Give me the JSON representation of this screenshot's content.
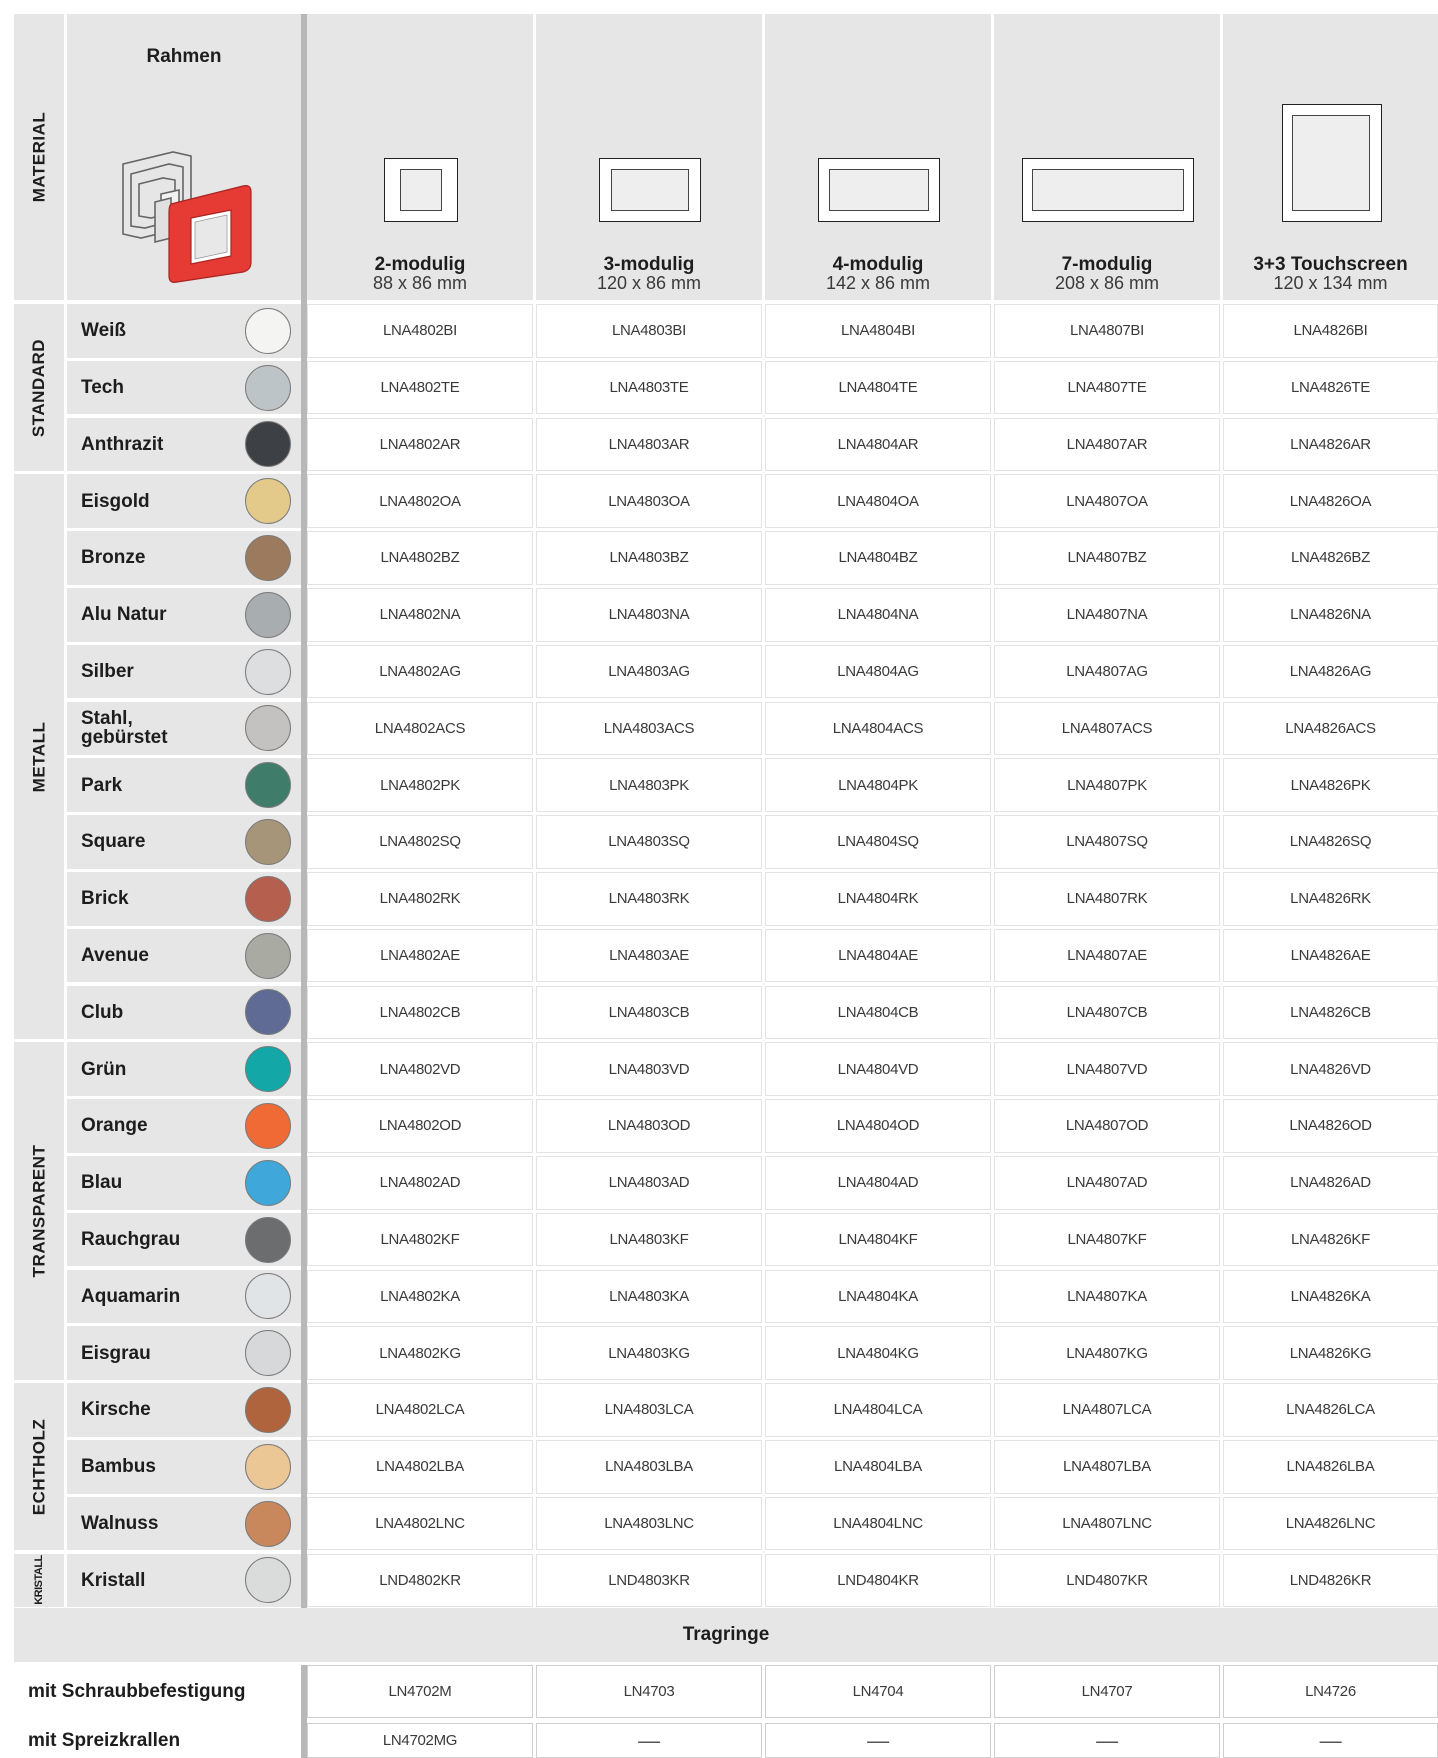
{
  "header": {
    "corner_label": "MATERIAL",
    "frame_title": "Rahmen",
    "columns": [
      {
        "title": "2-modulig",
        "dims": "88 x 86 mm"
      },
      {
        "title": "3-modulig",
        "dims": "120 x 86 mm"
      },
      {
        "title": "4-modulig",
        "dims": "142 x 86 mm"
      },
      {
        "title": "7-modulig",
        "dims": "208 x 86 mm"
      },
      {
        "title": "3+3 Touchscreen",
        "dims": "120 x 134 mm"
      }
    ]
  },
  "groups": [
    {
      "label": "STANDARD"
    },
    {
      "label": "METALL"
    },
    {
      "label": "TRANSPARENT"
    },
    {
      "label": "ECHTHOLZ"
    },
    {
      "label": "KRISTALL"
    }
  ],
  "rows": [
    {
      "name": "Weiß",
      "color": "#f4f4f2",
      "codes": [
        "LNA4802BI",
        "LNA4803BI",
        "LNA4804BI",
        "LNA4807BI",
        "LNA4826BI"
      ]
    },
    {
      "name": "Tech",
      "color": "#bcc4c8",
      "codes": [
        "LNA4802TE",
        "LNA4803TE",
        "LNA4804TE",
        "LNA4807TE",
        "LNA4826TE"
      ]
    },
    {
      "name": "Anthrazit",
      "color": "#3d4146",
      "codes": [
        "LNA4802AR",
        "LNA4803AR",
        "LNA4804AR",
        "LNA4807AR",
        "LNA4826AR"
      ]
    },
    {
      "name": "Eisgold",
      "color": "#e3c98a",
      "codes": [
        "LNA4802OA",
        "LNA4803OA",
        "LNA4804OA",
        "LNA4807OA",
        "LNA4826OA"
      ]
    },
    {
      "name": "Bronze",
      "color": "#9c7a5e",
      "codes": [
        "LNA4802BZ",
        "LNA4803BZ",
        "LNA4804BZ",
        "LNA4807BZ",
        "LNA4826BZ"
      ]
    },
    {
      "name": "Alu Natur",
      "color": "#a8adb0",
      "codes": [
        "LNA4802NA",
        "LNA4803NA",
        "LNA4804NA",
        "LNA4807NA",
        "LNA4826NA"
      ]
    },
    {
      "name": "Silber",
      "color": "#dcdedf",
      "codes": [
        "LNA4802AG",
        "LNA4803AG",
        "LNA4804AG",
        "LNA4807AG",
        "LNA4826AG"
      ]
    },
    {
      "name": "Stahl,\ngebürstet",
      "color": "#c4c2c0",
      "codes": [
        "LNA4802ACS",
        "LNA4803ACS",
        "LNA4804ACS",
        "LNA4807ACS",
        "LNA4826ACS"
      ]
    },
    {
      "name": "Park",
      "color": "#3f7c6a",
      "codes": [
        "LNA4802PK",
        "LNA4803PK",
        "LNA4804PK",
        "LNA4807PK",
        "LNA4826PK"
      ]
    },
    {
      "name": "Square",
      "color": "#a69578",
      "codes": [
        "LNA4802SQ",
        "LNA4803SQ",
        "LNA4804SQ",
        "LNA4807SQ",
        "LNA4826SQ"
      ]
    },
    {
      "name": "Brick",
      "color": "#b55f4f",
      "codes": [
        "LNA4802RK",
        "LNA4803RK",
        "LNA4804RK",
        "LNA4807RK",
        "LNA4826RK"
      ]
    },
    {
      "name": "Avenue",
      "color": "#a9aaa2",
      "codes": [
        "LNA4802AE",
        "LNA4803AE",
        "LNA4804AE",
        "LNA4807AE",
        "LNA4826AE"
      ]
    },
    {
      "name": "Club",
      "color": "#5f6a95",
      "codes": [
        "LNA4802CB",
        "LNA4803CB",
        "LNA4804CB",
        "LNA4807CB",
        "LNA4826CB"
      ]
    },
    {
      "name": "Grün",
      "color": "#14a7a7",
      "codes": [
        "LNA4802VD",
        "LNA4803VD",
        "LNA4804VD",
        "LNA4807VD",
        "LNA4826VD"
      ]
    },
    {
      "name": "Orange",
      "color": "#ef6a35",
      "codes": [
        "LNA4802OD",
        "LNA4803OD",
        "LNA4804OD",
        "LNA4807OD",
        "LNA4826OD"
      ]
    },
    {
      "name": "Blau",
      "color": "#3fa7d9",
      "codes": [
        "LNA4802AD",
        "LNA4803AD",
        "LNA4804AD",
        "LNA4807AD",
        "LNA4826AD"
      ]
    },
    {
      "name": "Rauchgrau",
      "color": "#6b6d6f",
      "codes": [
        "LNA4802KF",
        "LNA4803KF",
        "LNA4804KF",
        "LNA4807KF",
        "LNA4826KF"
      ]
    },
    {
      "name": "Aquamarin",
      "color": "#e0e4e6",
      "codes": [
        "LNA4802KA",
        "LNA4803KA",
        "LNA4804KA",
        "LNA4807KA",
        "LNA4826KA"
      ]
    },
    {
      "name": "Eisgrau",
      "color": "#d6d8d9",
      "codes": [
        "LNA4802KG",
        "LNA4803KG",
        "LNA4804KG",
        "LNA4807KG",
        "LNA4826KG"
      ]
    },
    {
      "name": "Kirsche",
      "color": "#b0643d",
      "codes": [
        "LNA4802LCA",
        "LNA4803LCA",
        "LNA4804LCA",
        "LNA4807LCA",
        "LNA4826LCA"
      ]
    },
    {
      "name": "Bambus",
      "color": "#ecc796",
      "codes": [
        "LNA4802LBA",
        "LNA4803LBA",
        "LNA4804LBA",
        "LNA4807LBA",
        "LNA4826LBA"
      ]
    },
    {
      "name": "Walnuss",
      "color": "#c8885b",
      "codes": [
        "LNA4802LNC",
        "LNA4803LNC",
        "LNA4804LNC",
        "LNA4807LNC",
        "LNA4826LNC"
      ]
    },
    {
      "name": "Kristall",
      "color": "#d9dcdb",
      "codes": [
        "LND4802KR",
        "LND4803KR",
        "LND4804KR",
        "LND4807KR",
        "LND4826KR"
      ]
    }
  ],
  "tragringe": {
    "title": "Tragringe",
    "rows": [
      {
        "label": "mit Schraubbefestigung",
        "codes": [
          "LN4702M",
          "LN4703",
          "LN4704",
          "LN4707",
          "LN4726"
        ]
      },
      {
        "label": "mit Spreizkrallen",
        "codes": [
          "LN4702MG",
          "—",
          "—",
          "—",
          "—"
        ]
      }
    ]
  },
  "icons": {
    "frame_product_image": "frame-assembly-icon",
    "module_frame": "frame-outline-icon",
    "swatch": "color-swatch-icon"
  }
}
